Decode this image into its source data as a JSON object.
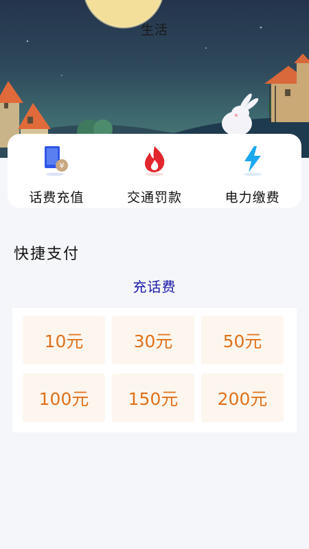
{
  "header": {
    "title": "生活"
  },
  "services": [
    {
      "label": "话费充值",
      "icon": "phone-recharge-icon",
      "color": "#2f56e8"
    },
    {
      "label": "交通罚款",
      "icon": "flame-icon",
      "color": "#e2262d"
    },
    {
      "label": "电力缴费",
      "icon": "lightning-icon",
      "color": "#1aa8f0"
    }
  ],
  "quick_pay": {
    "title": "快捷支付",
    "subtitle": "充话费",
    "amounts": [
      "10元",
      "30元",
      "50元",
      "100元",
      "150元",
      "200元"
    ],
    "accent": "#e0711b",
    "tile_bg": "#fdf6ee"
  }
}
